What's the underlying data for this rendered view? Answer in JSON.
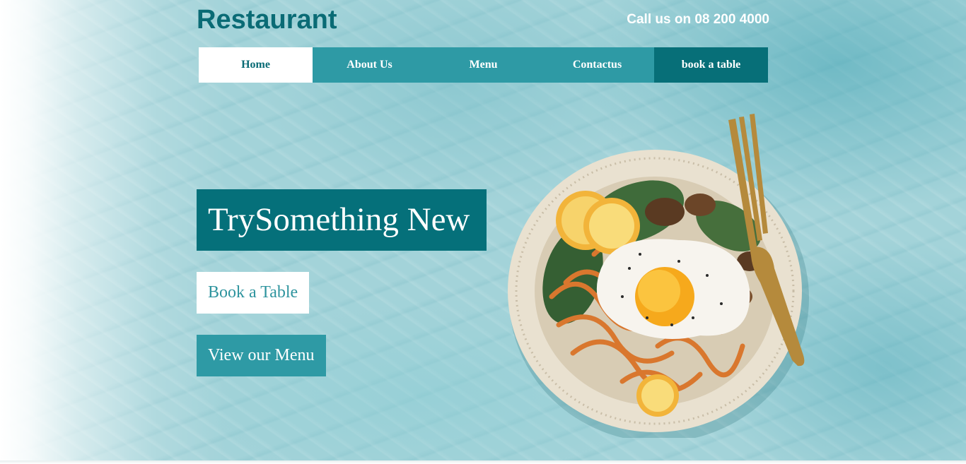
{
  "header": {
    "brand": "Restaurant",
    "phone": "Call us on 08 200 4000"
  },
  "nav": {
    "items": [
      {
        "label": "Home",
        "active": true
      },
      {
        "label": "About Us",
        "active": false
      },
      {
        "label": "Menu",
        "active": false
      },
      {
        "label": "Contactus",
        "active": false
      },
      {
        "label": "book a table",
        "active": false
      }
    ]
  },
  "hero": {
    "headline": "TrySomething New",
    "book_button": "Book a Table",
    "menu_button": "View our Menu",
    "image_icon": "food-dish-icon"
  },
  "colors": {
    "brand_dark": "#0a6b75",
    "nav_teal": "#2e9aa5",
    "cta_teal": "#076f78",
    "background": "#a3d3d9"
  }
}
